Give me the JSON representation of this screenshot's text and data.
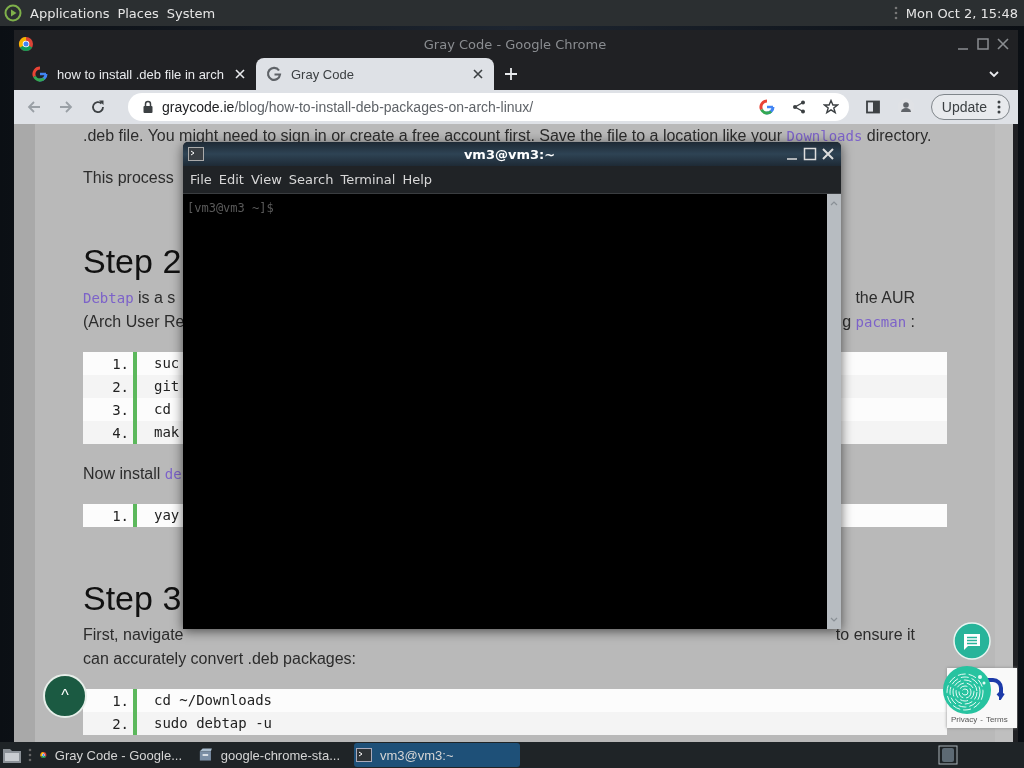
{
  "top_panel": {
    "menus": [
      "Applications",
      "Places",
      "System"
    ],
    "clock": "Mon Oct  2, 15:48"
  },
  "browser": {
    "title": "Gray Code - Google Chrome",
    "tabs": [
      {
        "label": "how to install .deb file in arch",
        "selected": false
      },
      {
        "label": "Gray Code",
        "selected": true
      }
    ],
    "url_host": "graycode.ie",
    "url_path": "/blog/how-to-install-deb-packages-on-arch-linux/",
    "update_button": "Update"
  },
  "page": {
    "blocks": [
      {
        "kind": "para",
        "lines": [
          {
            "left": [
              {
                "text": ".deb file.  You might need to sign in or create a free account first. Save the file to a location like your ",
                "code": false
              },
              {
                "text": "Downloads",
                "code": true
              },
              {
                "text": " directory.",
                "code": false
              }
            ]
          }
        ]
      },
      {
        "kind": "para",
        "lines": [
          {
            "left": [
              {
                "text": "This process",
                "code": false
              }
            ]
          }
        ]
      },
      {
        "kind": "heading",
        "text": "Step 2"
      },
      {
        "kind": "para",
        "lines": [
          {
            "left": [
              {
                "text": "Debtap",
                "code": true
              },
              {
                "text": " is a s",
                "code": false
              }
            ],
            "right": [
              {
                "text": "the AUR",
                "code": false
              }
            ]
          },
          {
            "left": [
              {
                "text": "(Arch User Re",
                "code": false
              }
            ],
            "right": [
              {
                "text": "g ",
                "code": false
              },
              {
                "text": "pacman",
                "code": true
              },
              {
                "text": " :",
                "code": false
              }
            ]
          }
        ]
      },
      {
        "kind": "code",
        "rows": [
          {
            "number": "1.",
            "code": "suc"
          },
          {
            "number": "2.",
            "code": "git"
          },
          {
            "number": "3.",
            "code": "cd"
          },
          {
            "number": "4.",
            "code": "mak"
          }
        ]
      },
      {
        "kind": "para",
        "lines": [
          {
            "left": [
              {
                "text": "Now install ",
                "code": false
              },
              {
                "text": "de",
                "code": true
              }
            ]
          }
        ]
      },
      {
        "kind": "code",
        "rows": [
          {
            "number": "1.",
            "code": "yay"
          }
        ]
      },
      {
        "kind": "heading",
        "text": "Step 3"
      },
      {
        "kind": "para",
        "lines": [
          {
            "left": [
              {
                "text": "First, navigate",
                "code": false
              }
            ],
            "right": [
              {
                "text": "to ensure it",
                "code": false
              }
            ]
          },
          {
            "left": [
              {
                "text": "can accurately convert .deb packages:",
                "code": false
              }
            ]
          }
        ]
      },
      {
        "kind": "code",
        "rows": [
          {
            "number": "1.",
            "code": "cd ~/Downloads"
          },
          {
            "number": "2.",
            "code": "sudo debtap -u"
          }
        ]
      }
    ],
    "back_to_top": "^",
    "recaptcha": {
      "links": [
        "Privacy",
        "Terms"
      ],
      "separator": "-"
    }
  },
  "terminal": {
    "title": "vm3@vm3:~",
    "menus": [
      "File",
      "Edit",
      "View",
      "Search",
      "Terminal",
      "Help"
    ],
    "prompt": "[vm3@vm3 ~]$"
  },
  "taskbar": {
    "items": [
      {
        "label": "Gray Code - Google...",
        "kind": "browser",
        "selected": false
      },
      {
        "label": "google-chrome-sta...",
        "kind": "package",
        "selected": false
      },
      {
        "label": "vm3@vm3:~",
        "kind": "terminal",
        "selected": true
      }
    ]
  }
}
